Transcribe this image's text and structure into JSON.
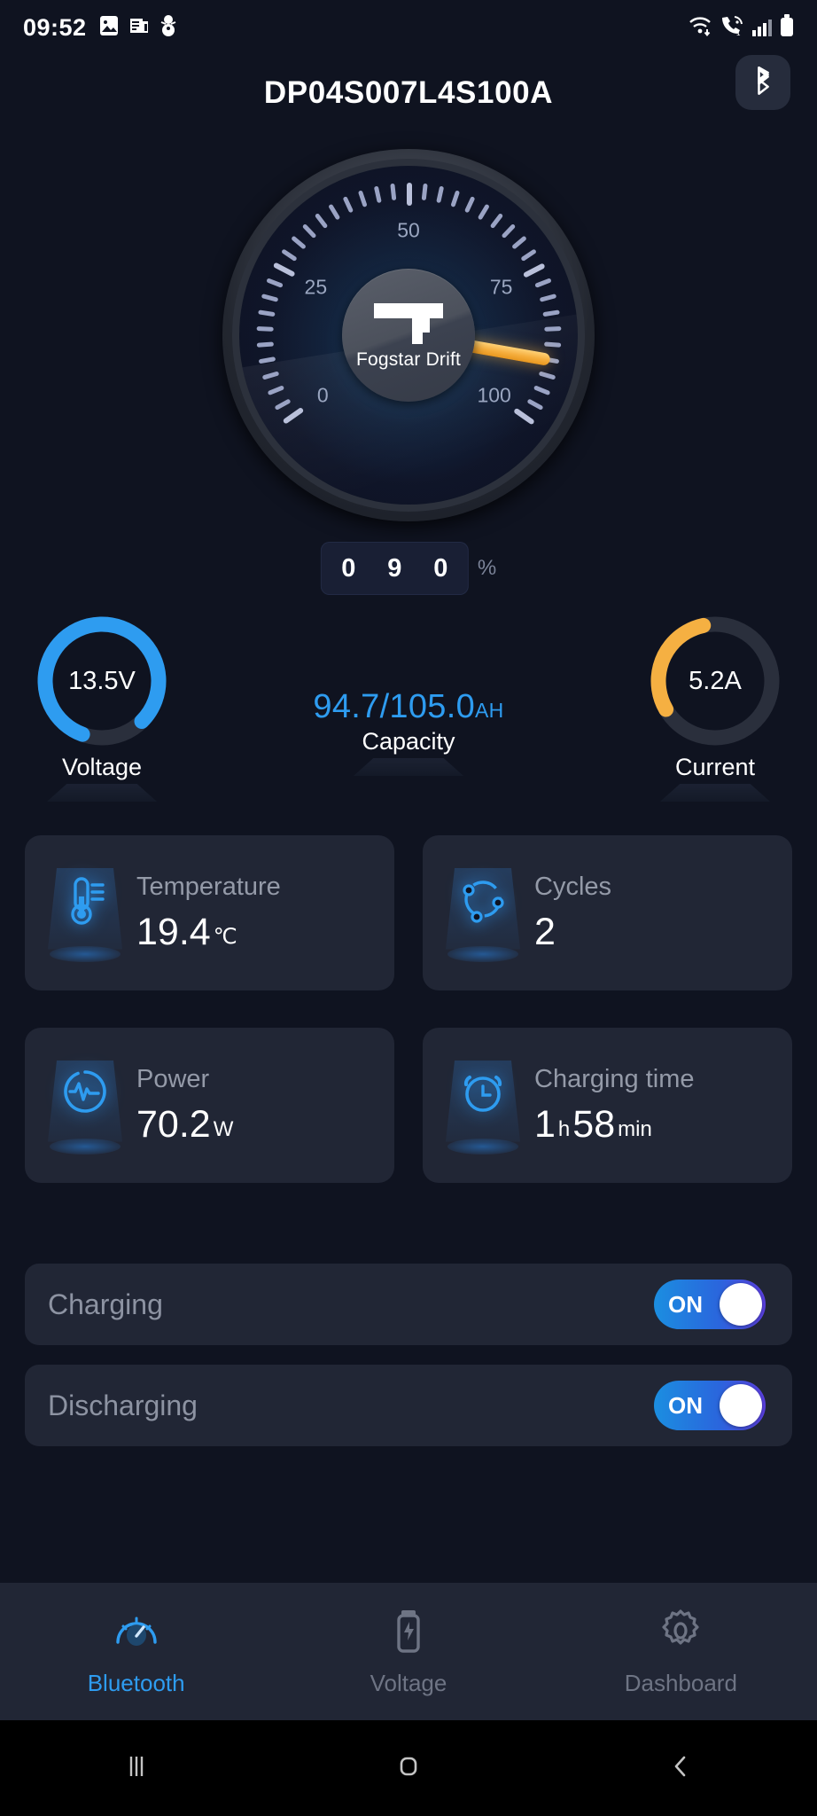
{
  "statusbar": {
    "time": "09:52",
    "left_icons": [
      "image-icon",
      "news-icon",
      "snowman-icon"
    ],
    "right_icons": [
      "wifi-icon",
      "call-wifi-icon",
      "signal-icon",
      "battery-icon"
    ]
  },
  "appbar": {
    "title": "DP04S007L4S100A",
    "bluetooth_icon": "bluetooth-icon"
  },
  "gauge": {
    "brand": "Fogstar Drift",
    "tick_labels": [
      "0",
      "25",
      "50",
      "75",
      "100"
    ],
    "needle_value": 90,
    "min": 0,
    "max": 100,
    "percent_digits": [
      "0",
      "9",
      "0"
    ],
    "percent_unit": "%",
    "needle_color": "#f5ad3c"
  },
  "rings": [
    {
      "name": "voltage",
      "value": "13.5V",
      "label": "Voltage",
      "color": "#2e9cf0",
      "fill": 0.82
    },
    {
      "name": "current",
      "value": "5.2A",
      "label": "Current",
      "color": "#f5b042",
      "fill": 0.3
    }
  ],
  "capacity": {
    "value": "94.7/105.0",
    "unit": "AH",
    "label": "Capacity",
    "color": "#2e9cf0"
  },
  "cards": [
    {
      "icon": "thermometer-icon",
      "label": "Temperature",
      "value": "19.4",
      "unit": "℃",
      "value2": "",
      "unit2": ""
    },
    {
      "icon": "cycles-icon",
      "label": "Cycles",
      "value": "2",
      "unit": "",
      "value2": "",
      "unit2": ""
    },
    {
      "icon": "power-pulse-icon",
      "label": "Power",
      "value": "70.2",
      "unit": "W",
      "value2": "",
      "unit2": ""
    },
    {
      "icon": "alarm-clock-icon",
      "label": "Charging time",
      "value": "1",
      "unit": "h",
      "value2": "58",
      "unit2": "min"
    }
  ],
  "switches": [
    {
      "label": "Charging",
      "state": "ON"
    },
    {
      "label": "Discharging",
      "state": "ON"
    }
  ],
  "bottomnav": [
    {
      "icon": "gauge-icon",
      "label": "Bluetooth",
      "active": true
    },
    {
      "icon": "battery-bolt-icon",
      "label": "Voltage",
      "active": false
    },
    {
      "icon": "gear-icon",
      "label": "Dashboard",
      "active": false
    }
  ],
  "sysnav": [
    "recents-icon",
    "home-icon",
    "back-icon"
  ]
}
